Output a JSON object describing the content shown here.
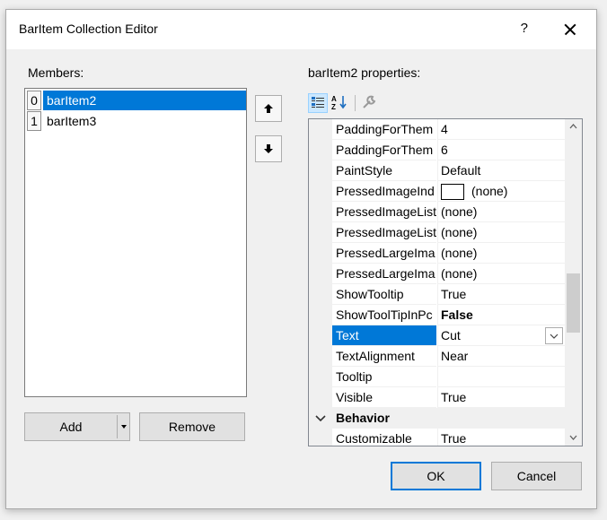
{
  "window": {
    "title": "BarItem Collection Editor",
    "help": "?"
  },
  "members": {
    "label": "Members:",
    "items": [
      {
        "index": "0",
        "name": "barItem2"
      },
      {
        "index": "1",
        "name": "barItem3"
      }
    ]
  },
  "buttons": {
    "add": "Add",
    "remove": "Remove",
    "ok": "OK",
    "cancel": "Cancel"
  },
  "properties": {
    "label": "barItem2 properties:",
    "rows": [
      {
        "name": "PaddingForThem",
        "value": "4"
      },
      {
        "name": "PaddingForThem",
        "value": "6"
      },
      {
        "name": "PaintStyle",
        "value": "Default"
      },
      {
        "name": "PressedImageInd",
        "value": "(none)"
      },
      {
        "name": "PressedImageList",
        "value": "(none)"
      },
      {
        "name": "PressedImageList",
        "value": "(none)"
      },
      {
        "name": "PressedLargeIma",
        "value": "(none)"
      },
      {
        "name": "PressedLargeIma",
        "value": "(none)"
      },
      {
        "name": "ShowTooltip",
        "value": "True"
      },
      {
        "name": "ShowToolTipInPc",
        "value": "False"
      },
      {
        "name": "Text",
        "value": "Cut"
      },
      {
        "name": "TextAlignment",
        "value": "Near"
      },
      {
        "name": "Tooltip",
        "value": ""
      },
      {
        "name": "Visible",
        "value": "True"
      }
    ],
    "category": "Behavior",
    "after_category": [
      {
        "name": "Customizable",
        "value": "True"
      }
    ]
  },
  "colors": {
    "selection": "#0078d7"
  }
}
